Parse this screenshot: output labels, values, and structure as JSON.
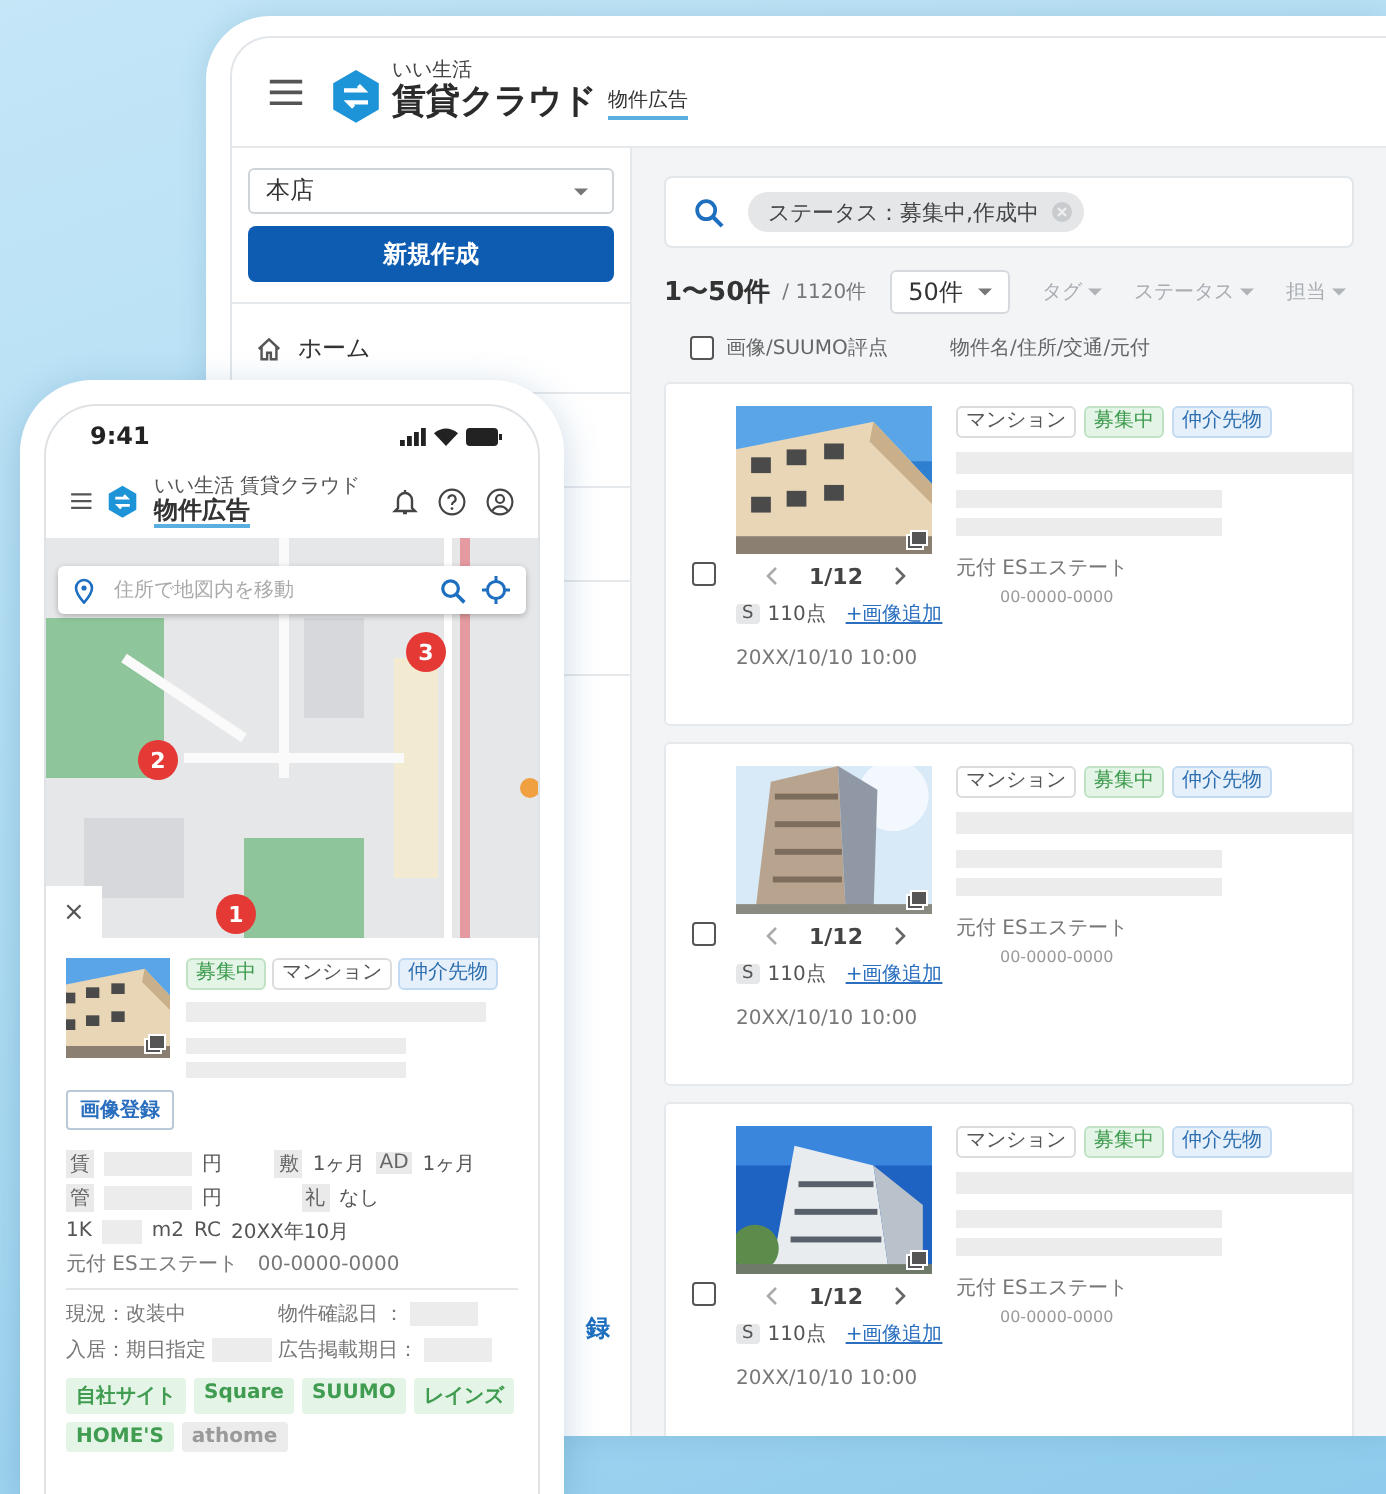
{
  "desktop": {
    "header": {
      "brand_small": "いい生活",
      "brand": "賃貸クラウド",
      "product": "物件広告"
    },
    "sidebar": {
      "store_select": {
        "value": "本店"
      },
      "new_button": "新規作成",
      "items": [
        {
          "label": "ホーム"
        }
      ],
      "bottom_link": "録"
    },
    "search": {
      "chips": [
        {
          "label": "ステータス：募集中,作成中"
        }
      ]
    },
    "results": {
      "range": "1〜50件",
      "total": "/ 1120件",
      "per_page": "50件",
      "filters": [
        {
          "label": "タグ",
          "kind": "dropdown"
        },
        {
          "label": "ステータス",
          "kind": "dropdown"
        },
        {
          "label": "担当",
          "kind": "dropdown"
        }
      ]
    },
    "select_all": {
      "checked": false
    },
    "columns": [
      "画像/SUUMO評点",
      "物件名/住所/交通/元付"
    ],
    "cards": [
      {
        "checked": false,
        "page": "1/12",
        "score_grade": "S",
        "score": "110点",
        "add_image": "+画像追加",
        "date": "20XX/10/10 10:00",
        "tags": [
          {
            "label": "マンション",
            "kind": "type"
          },
          {
            "label": "募集中",
            "kind": "status"
          },
          {
            "label": "仲介先物",
            "kind": "broker"
          }
        ],
        "agent": "元付 ESエステート",
        "phone": "00-0000-0000"
      },
      {
        "checked": false,
        "page": "1/12",
        "score_grade": "S",
        "score": "110点",
        "add_image": "+画像追加",
        "date": "20XX/10/10 10:00",
        "tags": [
          {
            "label": "マンション",
            "kind": "type"
          },
          {
            "label": "募集中",
            "kind": "status"
          },
          {
            "label": "仲介先物",
            "kind": "broker"
          }
        ],
        "agent": "元付 ESエステート",
        "phone": "00-0000-0000"
      },
      {
        "checked": false,
        "page": "1/12",
        "score_grade": "S",
        "score": "110点",
        "add_image": "+画像追加",
        "date": "20XX/10/10 10:00",
        "tags": [
          {
            "label": "マンション",
            "kind": "type"
          },
          {
            "label": "募集中",
            "kind": "status"
          },
          {
            "label": "仲介先物",
            "kind": "broker"
          }
        ],
        "agent": "元付 ESエステート",
        "phone": "00-0000-0000"
      }
    ]
  },
  "phone": {
    "time": "9:41",
    "brand_small": "いい生活 賃貸クラウド",
    "product": "物件広告",
    "map_search": {
      "placeholder": "住所で地図内を移動"
    },
    "markers": [
      {
        "label": "3"
      },
      {
        "label": "2"
      },
      {
        "label": "1"
      }
    ],
    "close": "×",
    "listing": {
      "tags": [
        {
          "label": "募集中",
          "kind": "status"
        },
        {
          "label": "マンション",
          "kind": "type"
        },
        {
          "label": "仲介先物",
          "kind": "broker"
        }
      ],
      "image_button": "画像登録",
      "rent": {
        "label": "賃",
        "unit": "円"
      },
      "deposit": {
        "label": "敷",
        "value": "1ヶ月"
      },
      "ad": {
        "label": "AD",
        "value": "1ヶ月"
      },
      "management": {
        "label": "管",
        "unit": "円"
      },
      "key_money": {
        "label": "礼",
        "value": "なし"
      },
      "layout": "1K",
      "area_unit": "m2",
      "structure": "RC",
      "built": "20XX年10月",
      "agent": "元付 ESエステート",
      "phone": "00-0000-0000",
      "condition": "現況：改装中",
      "checked_date_label": "物件確認日 ：",
      "move_in": "入居：期日指定",
      "ad_end_label": "広告掲載期日：",
      "portals": [
        {
          "label": "自社サイト",
          "on": true
        },
        {
          "label": "Square",
          "on": true
        },
        {
          "label": "SUUMO",
          "on": true
        },
        {
          "label": "レインズ",
          "on": true
        },
        {
          "label": "HOME'S",
          "on": true
        },
        {
          "label": "athome",
          "on": false
        }
      ]
    }
  }
}
